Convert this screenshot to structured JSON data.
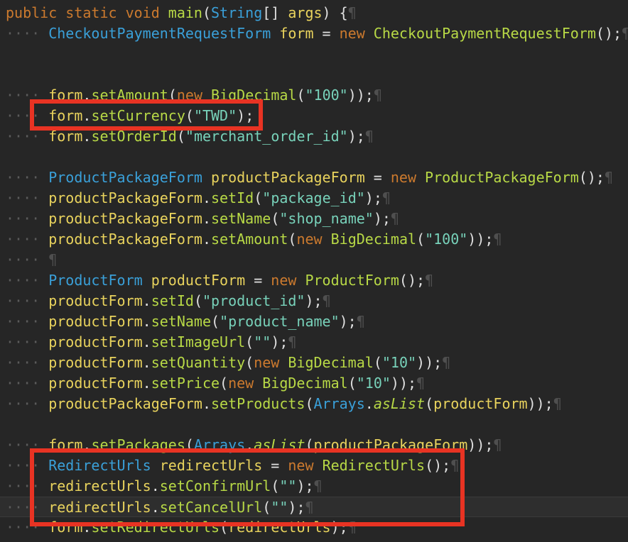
{
  "code": {
    "lines": [
      [
        [
          "kw",
          "public static void "
        ],
        [
          "fn",
          "main"
        ],
        [
          "op",
          "("
        ],
        [
          "ty",
          "String"
        ],
        [
          "op",
          "[] "
        ],
        [
          "var",
          "args"
        ],
        [
          "op",
          ") {"
        ],
        [
          "pm",
          "¶"
        ]
      ],
      [
        [
          "ws",
          "···· "
        ],
        [
          "ty",
          "CheckoutPaymentRequestForm "
        ],
        [
          "var",
          "form"
        ],
        [
          "op",
          " = "
        ],
        [
          "kw",
          "new "
        ],
        [
          "fn",
          "CheckoutPaymentRequestForm"
        ],
        [
          "op",
          "();"
        ],
        [
          "pm",
          "¶"
        ]
      ],
      [],
      [],
      [
        [
          "ws",
          "···· "
        ],
        [
          "var",
          "form"
        ],
        [
          "op",
          "."
        ],
        [
          "fn",
          "setAmount"
        ],
        [
          "op",
          "("
        ],
        [
          "kw",
          "new "
        ],
        [
          "fn",
          "BigDecimal"
        ],
        [
          "op",
          "("
        ],
        [
          "st",
          "\"100\""
        ],
        [
          "op",
          "));"
        ],
        [
          "pm",
          "¶"
        ]
      ],
      [
        [
          "ws",
          "···· "
        ],
        [
          "var",
          "form"
        ],
        [
          "op",
          "."
        ],
        [
          "fn",
          "setCurrency"
        ],
        [
          "op",
          "("
        ],
        [
          "st",
          "\"TWD\""
        ],
        [
          "op",
          ");"
        ]
      ],
      [
        [
          "ws",
          "···· "
        ],
        [
          "var",
          "form"
        ],
        [
          "op",
          "."
        ],
        [
          "fn",
          "setOrderId"
        ],
        [
          "op",
          "("
        ],
        [
          "st",
          "\"merchant_order_id\""
        ],
        [
          "op",
          ");"
        ],
        [
          "pm",
          "¶"
        ]
      ],
      [],
      [
        [
          "ws",
          "···· "
        ],
        [
          "ty",
          "ProductPackageForm "
        ],
        [
          "var",
          "productPackageForm"
        ],
        [
          "op",
          " = "
        ],
        [
          "kw",
          "new "
        ],
        [
          "fn",
          "ProductPackageForm"
        ],
        [
          "op",
          "();"
        ],
        [
          "pm",
          "¶"
        ]
      ],
      [
        [
          "ws",
          "···· "
        ],
        [
          "var",
          "productPackageForm"
        ],
        [
          "op",
          "."
        ],
        [
          "fn",
          "setId"
        ],
        [
          "op",
          "("
        ],
        [
          "st",
          "\"package_id\""
        ],
        [
          "op",
          ");"
        ],
        [
          "pm",
          "¶"
        ]
      ],
      [
        [
          "ws",
          "···· "
        ],
        [
          "var",
          "productPackageForm"
        ],
        [
          "op",
          "."
        ],
        [
          "fn",
          "setName"
        ],
        [
          "op",
          "("
        ],
        [
          "st",
          "\"shop_name\""
        ],
        [
          "op",
          ");"
        ],
        [
          "pm",
          "¶"
        ]
      ],
      [
        [
          "ws",
          "···· "
        ],
        [
          "var",
          "productPackageForm"
        ],
        [
          "op",
          "."
        ],
        [
          "fn",
          "setAmount"
        ],
        [
          "op",
          "("
        ],
        [
          "kw",
          "new "
        ],
        [
          "fn",
          "BigDecimal"
        ],
        [
          "op",
          "("
        ],
        [
          "st",
          "\"100\""
        ],
        [
          "op",
          "));"
        ],
        [
          "pm",
          "¶"
        ]
      ],
      [
        [
          "ws",
          "···· "
        ],
        [
          "pm",
          "¶"
        ]
      ],
      [
        [
          "ws",
          "···· "
        ],
        [
          "ty",
          "ProductForm "
        ],
        [
          "var",
          "productForm"
        ],
        [
          "op",
          " = "
        ],
        [
          "kw",
          "new "
        ],
        [
          "fn",
          "ProductForm"
        ],
        [
          "op",
          "();"
        ],
        [
          "pm",
          "¶"
        ]
      ],
      [
        [
          "ws",
          "···· "
        ],
        [
          "var",
          "productForm"
        ],
        [
          "op",
          "."
        ],
        [
          "fn",
          "setId"
        ],
        [
          "op",
          "("
        ],
        [
          "st",
          "\"product_id\""
        ],
        [
          "op",
          ");"
        ],
        [
          "pm",
          "¶"
        ]
      ],
      [
        [
          "ws",
          "···· "
        ],
        [
          "var",
          "productForm"
        ],
        [
          "op",
          "."
        ],
        [
          "fn",
          "setName"
        ],
        [
          "op",
          "("
        ],
        [
          "st",
          "\"product_name\""
        ],
        [
          "op",
          ");"
        ],
        [
          "pm",
          "¶"
        ]
      ],
      [
        [
          "ws",
          "···· "
        ],
        [
          "var",
          "productForm"
        ],
        [
          "op",
          "."
        ],
        [
          "fn",
          "setImageUrl"
        ],
        [
          "op",
          "("
        ],
        [
          "st",
          "\"\""
        ],
        [
          "op",
          ");"
        ],
        [
          "pm",
          "¶"
        ]
      ],
      [
        [
          "ws",
          "···· "
        ],
        [
          "var",
          "productForm"
        ],
        [
          "op",
          "."
        ],
        [
          "fn",
          "setQuantity"
        ],
        [
          "op",
          "("
        ],
        [
          "kw",
          "new "
        ],
        [
          "fn",
          "BigDecimal"
        ],
        [
          "op",
          "("
        ],
        [
          "st",
          "\"10\""
        ],
        [
          "op",
          "));"
        ],
        [
          "pm",
          "¶"
        ]
      ],
      [
        [
          "ws",
          "···· "
        ],
        [
          "var",
          "productForm"
        ],
        [
          "op",
          "."
        ],
        [
          "fn",
          "setPrice"
        ],
        [
          "op",
          "("
        ],
        [
          "kw",
          "new "
        ],
        [
          "fn",
          "BigDecimal"
        ],
        [
          "op",
          "("
        ],
        [
          "st",
          "\"10\""
        ],
        [
          "op",
          "));"
        ],
        [
          "pm",
          "¶"
        ]
      ],
      [
        [
          "ws",
          "···· "
        ],
        [
          "var",
          "productPackageForm"
        ],
        [
          "op",
          "."
        ],
        [
          "fn",
          "setProducts"
        ],
        [
          "op",
          "("
        ],
        [
          "ty",
          "Arrays"
        ],
        [
          "op",
          "."
        ],
        [
          "it",
          "asList"
        ],
        [
          "op",
          "("
        ],
        [
          "var",
          "productForm"
        ],
        [
          "op",
          "));"
        ],
        [
          "pm",
          "¶"
        ]
      ],
      [],
      [
        [
          "ws",
          "···· "
        ],
        [
          "var",
          "form"
        ],
        [
          "op",
          "."
        ],
        [
          "fn",
          "setPackages"
        ],
        [
          "op",
          "("
        ],
        [
          "ty",
          "Arrays"
        ],
        [
          "op",
          "."
        ],
        [
          "it",
          "asList"
        ],
        [
          "op",
          "("
        ],
        [
          "var",
          "productPackageForm"
        ],
        [
          "op",
          "));"
        ],
        [
          "pm",
          "¶"
        ]
      ],
      [
        [
          "ws",
          "···· "
        ],
        [
          "ty",
          "RedirectUrls "
        ],
        [
          "var",
          "redirectUrls"
        ],
        [
          "op",
          " = "
        ],
        [
          "kw",
          "new "
        ],
        [
          "fn",
          "RedirectUrls"
        ],
        [
          "op",
          "();"
        ],
        [
          "pm",
          "¶"
        ]
      ],
      [
        [
          "ws",
          "···· "
        ],
        [
          "var",
          "redirectUrls"
        ],
        [
          "op",
          "."
        ],
        [
          "fn",
          "setConfirmUrl"
        ],
        [
          "op",
          "("
        ],
        [
          "st",
          "\"\""
        ],
        [
          "op",
          ");"
        ],
        [
          "pm",
          "¶"
        ]
      ],
      [
        [
          "ws",
          "···· "
        ],
        [
          "var",
          "redirectUrls"
        ],
        [
          "op",
          "."
        ],
        [
          "fn",
          "setCancelUrl"
        ],
        [
          "op",
          "("
        ],
        [
          "st",
          "\"\""
        ],
        [
          "op",
          ");"
        ],
        [
          "pm",
          "¶"
        ]
      ],
      [
        [
          "ws",
          "···· "
        ],
        [
          "var",
          "form"
        ],
        [
          "op",
          "."
        ],
        [
          "fn",
          "setRedirectUrls"
        ],
        [
          "op",
          "("
        ],
        [
          "var",
          "redirectUrls"
        ],
        [
          "op",
          ");"
        ],
        [
          "pm",
          "¶"
        ]
      ]
    ],
    "current_line": 24
  },
  "highlights": [
    {
      "label": "setCurrency-highlight"
    },
    {
      "label": "redirect-urls-highlight"
    }
  ],
  "colors": {
    "background": "#262626",
    "keyword": "#cc7a2e",
    "type": "#3aa0d9",
    "variable": "#e9d35d",
    "method": "#b8d946",
    "string": "#78d2ba",
    "highlight_box": "#e83323"
  }
}
